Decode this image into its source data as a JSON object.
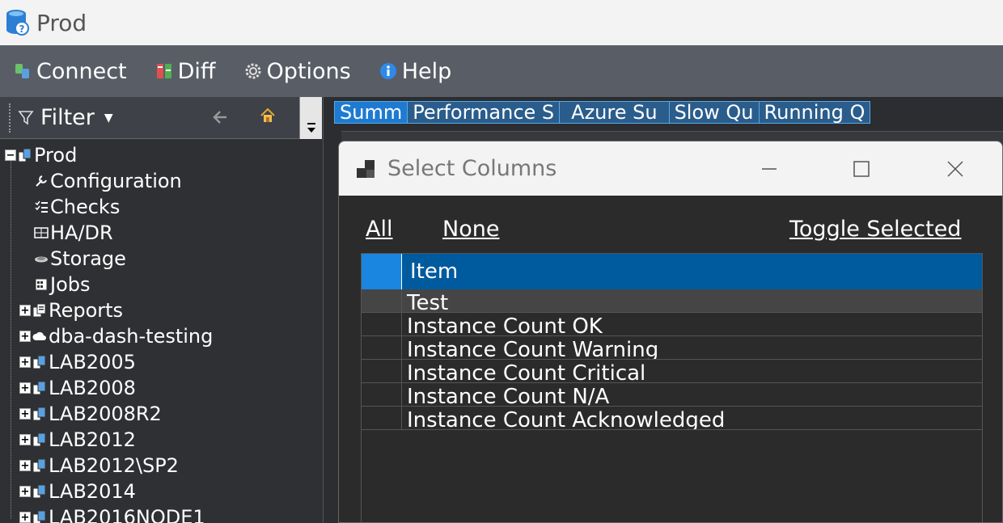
{
  "window": {
    "title": "Prod"
  },
  "menu": {
    "connect": "Connect",
    "diff": "Diff",
    "options": "Options",
    "help": "Help"
  },
  "filter": {
    "label": "Filter"
  },
  "tree": {
    "root": "Prod",
    "children": [
      "Configuration",
      "Checks",
      "HA/DR",
      "Storage",
      "Jobs",
      "Reports",
      "dba-dash-testing",
      "LAB2005",
      "LAB2008",
      "LAB2008R2",
      "LAB2012",
      "LAB2012\\SP2",
      "LAB2014",
      "LAB2016NODE1"
    ]
  },
  "tabs": [
    "Summ",
    "Performance S",
    "Azure Su",
    "Slow Qu",
    "Running Q"
  ],
  "dialog": {
    "title": "Select Columns",
    "links": {
      "all": "All",
      "none": "None",
      "toggle": "Toggle Selected"
    },
    "grid": {
      "header": "Item",
      "rows": [
        "Test",
        "Instance Count OK",
        "Instance Count Warning",
        "Instance Count Critical",
        "Instance Count N/A",
        "Instance Count Acknowledged"
      ]
    }
  },
  "colors": {
    "menubar": "#595d66",
    "header_blue": "#005a9e",
    "tab_active": "#1e7bd1"
  }
}
